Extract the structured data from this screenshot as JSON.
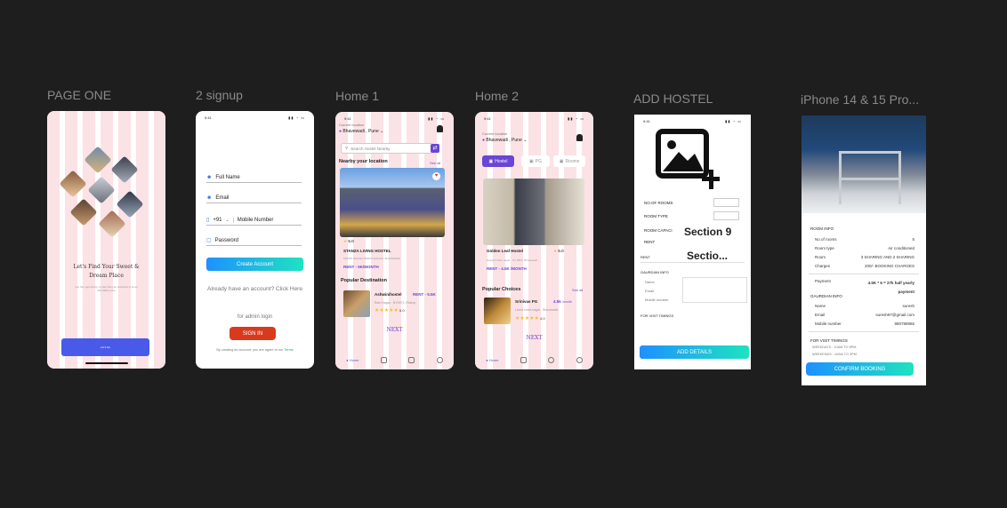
{
  "canvas": {
    "bg": "#1e1e1e"
  },
  "frames": {
    "page_one": {
      "label": "PAGE ONE",
      "headline": "Let's Find Your Sweet & Dream Place",
      "subtext": "Get the opportunity to stay that you dreamed of at an affordable price",
      "cta": "Let's Go"
    },
    "signup": {
      "label": "2 signup",
      "status_time": "9:41",
      "full_name": "Full Name",
      "email": "Email",
      "country_code": "+91",
      "mobile": "Mobile Number",
      "password": "Password",
      "create_account": "Create Account",
      "already": "Already have an account? Click Here",
      "admin": "for admin login",
      "sign_in": "SIGN IN",
      "terms_prefix": "By creating an account, you are agree to our",
      "terms_link": "Terms"
    },
    "home1": {
      "label": "Home 1",
      "status_time": "9:41",
      "location_caption": "Current location",
      "location": "Bhavewadi , Pune",
      "search_placeholder": "Search Hostel Nearby",
      "nearby": "Nearby your location",
      "see_all": "See all",
      "rating": "5.0",
      "hostel_name": "STANZA LIVING HOSTEL",
      "hostel_addr": "MAPPA NAGAR, BARKA NAGAR, BHAVEWADI",
      "rent": "RENT - 5K/MONTH",
      "popular": "Popular Destination",
      "pop_name": "Ashwinihostel",
      "pop_rent": "RENT - 5.5K",
      "pop_addr": "Ram Nagar , NY0972, Rideup",
      "pop_rating": "5.0",
      "next": "NEXT",
      "nav_home": "Home"
    },
    "home2": {
      "label": "Home 2",
      "status_time": "9:41",
      "location_caption": "Current location",
      "location": "Bhavewadi , Pune",
      "tabs": [
        "Hostel",
        "PG",
        "Rooms"
      ],
      "card_name": "Golden Leaf Hostel",
      "card_rating": "5.0",
      "card_addr": "Gayatri Indira nagar , NY 0872, Bhavewadi",
      "card_rent": "RENT - 4.5K /MONTH",
      "popular": "Popular Choices",
      "see_all": "See all",
      "pop_name": "Srinivas PG",
      "pop_price": "4.5k",
      "pop_unit": "/month",
      "pop_addr": "Laxmi Indra nagar , Bhavewadi",
      "pop_rating": "4.0",
      "next": "NEXT",
      "nav_home": "Home"
    },
    "add_hostel": {
      "label": "ADD HOSTEL",
      "status_time": "9:41",
      "no_rooms": "NO.OF ROOMS",
      "room_type": "ROOM TYPE",
      "room_cap": "ROOM CAPACI",
      "rent": "RENT",
      "rent2": "RENT",
      "section9": "Section 9",
      "section_trunc": "Sectio...",
      "guardian": "GAURDIAN INFO",
      "g_name": "Name",
      "g_email": "Email",
      "g_mobile": "Mobile number",
      "visit": "FOR VISIT TIMINGS",
      "add_details": "ADD DETAILS"
    },
    "iphone": {
      "label": "iPhone 14 & 15 Pro...",
      "room_info": "ROOM INFO",
      "rows": [
        {
          "k": "No.of rooms",
          "v": "5"
        },
        {
          "k": "Room type",
          "v": "Air conditioned"
        },
        {
          "k": "Room",
          "v": "3 SHARING AND 2 SHARING"
        },
        {
          "k": "Charges",
          "v": "200/- BOOKING CHARGES"
        }
      ],
      "payment_k": "Payment",
      "payment_v": "4.5K * 6 = 27k half yearly payment",
      "guardian": "GAURDIAN INFO",
      "g_rows": [
        {
          "k": "Name",
          "v": "suresh"
        },
        {
          "k": "Email",
          "v": "suresh97@gmail.com"
        },
        {
          "k": "Mobile number",
          "v": "880788966"
        }
      ],
      "visit": "FOR VISIT TIMINGS",
      "weekdays": "WEEKDAYS : 10AM TO 5PM",
      "weekends": "WEEKENDS : 10AM TO 3PM",
      "confirm": "CONFIRM BOOKING"
    }
  },
  "colors": {
    "gradient_start": "#1e90ff",
    "gradient_end": "#1ee3c0",
    "purple": "#6b45d6",
    "red": "#d83a1e",
    "blue_btn": "#4a5ae8"
  }
}
